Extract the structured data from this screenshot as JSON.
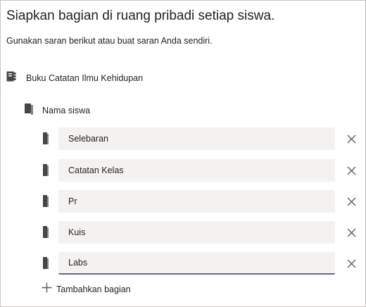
{
  "page": {
    "title": "Siapkan bagian di ruang pribadi setiap siswa.",
    "subtitle": "Gunakan saran berikut atau buat saran Anda sendiri."
  },
  "notebook": {
    "label": "Buku Catatan Ilmu Kehidupan",
    "icon": "notebook-icon"
  },
  "section_group": {
    "label": "Nama siswa",
    "icon": "section-group-icon"
  },
  "sections": [
    {
      "value": "Selebaran",
      "icon": "section-icon",
      "remove_icon": "close-icon"
    },
    {
      "value": "Catatan Kelas",
      "icon": "section-icon",
      "remove_icon": "close-icon"
    },
    {
      "value": "Pr",
      "icon": "section-icon",
      "remove_icon": "close-icon"
    },
    {
      "value": "Kuis",
      "icon": "section-icon",
      "remove_icon": "close-icon"
    },
    {
      "value": "Labs",
      "icon": "section-icon",
      "remove_icon": "close-icon",
      "focused": true
    }
  ],
  "add_section": {
    "label": "Tambahkan bagian",
    "icon": "plus-icon"
  },
  "colors": {
    "accent": "#6264a7",
    "field_bg": "#f3f2f1",
    "icon": "#484644",
    "text": "#252423"
  }
}
